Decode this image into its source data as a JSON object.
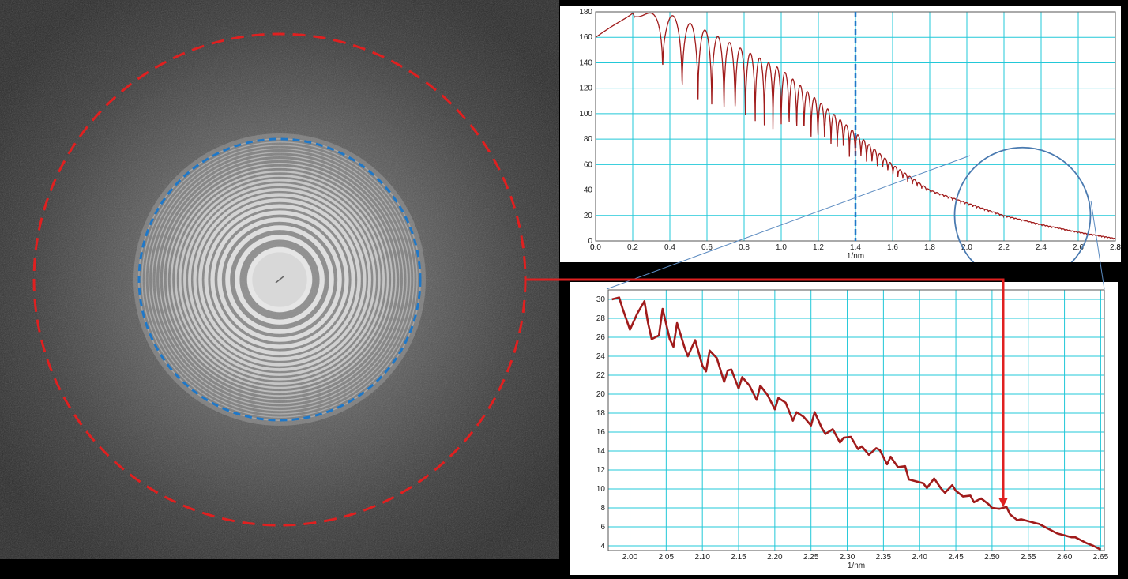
{
  "colors": {
    "curve": "#a01b1b",
    "grid": "#22c8d8",
    "marker_blue": "#1f78c8",
    "circle_red": "#e02020",
    "zoom_circle": "#4a7ab0",
    "highlight": "#ffee00"
  },
  "fft_image": {
    "description_icon": "thon-rings-fft-icon",
    "ring_count_visible": 19
  },
  "chart_data": [
    {
      "type": "line",
      "title": "",
      "xlabel": "1/nm",
      "ylabel": "",
      "xlim": [
        0.0,
        2.8
      ],
      "ylim": [
        0,
        180
      ],
      "x_ticks": [
        "0.0",
        "0.2",
        "0.4",
        "0.6",
        "0.8",
        "1.0",
        "1.2",
        "1.4",
        "1.6",
        "1.8",
        "2.0",
        "2.2",
        "2.4",
        "2.6",
        "2.8"
      ],
      "y_ticks": [
        "0",
        "20",
        "40",
        "60",
        "80",
        "100",
        "120",
        "140",
        "160",
        "180"
      ],
      "marker_x": 1.4,
      "envelope": {
        "x": [
          0.0,
          0.2,
          0.4,
          0.6,
          0.8,
          1.0,
          1.2,
          1.4,
          1.6,
          1.8,
          2.0,
          2.2,
          2.4,
          2.6,
          2.8
        ],
        "upper": [
          160,
          180,
          178,
          165,
          150,
          135,
          110,
          85,
          60,
          40,
          30,
          20,
          13,
          7,
          2
        ],
        "lower": [
          135,
          178,
          115,
          95,
          85,
          80,
          72,
          62,
          50,
          38,
          28,
          19,
          12,
          6,
          1
        ]
      },
      "zoom_circle_center_x": 2.3,
      "zoom_circle_center_y": 20
    },
    {
      "type": "line",
      "title": "",
      "xlabel": "1/nm",
      "ylabel": "",
      "xlim": [
        1.97,
        2.655
      ],
      "ylim": [
        3.5,
        31
      ],
      "x_ticks": [
        "2.00",
        "2.05",
        "2.10",
        "2.15",
        "2.20",
        "2.25",
        "2.30",
        "2.35",
        "2.40",
        "2.45",
        "2.50",
        "2.55",
        "2.60",
        "2.65"
      ],
      "y_ticks": [
        "4",
        "6",
        "8",
        "10",
        "12",
        "14",
        "16",
        "18",
        "20",
        "22",
        "24",
        "26",
        "28",
        "30"
      ],
      "x": [
        1.975,
        1.985,
        1.99,
        2.0,
        2.01,
        2.02,
        2.025,
        2.03,
        2.04,
        2.045,
        2.055,
        2.06,
        2.065,
        2.075,
        2.08,
        2.09,
        2.1,
        2.105,
        2.11,
        2.12,
        2.13,
        2.135,
        2.14,
        2.15,
        2.155,
        2.165,
        2.175,
        2.18,
        2.19,
        2.2,
        2.205,
        2.215,
        2.225,
        2.23,
        2.24,
        2.25,
        2.255,
        2.265,
        2.27,
        2.28,
        2.29,
        2.295,
        2.305,
        2.315,
        2.32,
        2.33,
        2.34,
        2.345,
        2.355,
        2.36,
        2.37,
        2.38,
        2.385,
        2.395,
        2.405,
        2.41,
        2.42,
        2.43,
        2.435,
        2.445,
        2.45,
        2.46,
        2.47,
        2.475,
        2.485,
        2.495,
        2.5,
        2.51,
        2.52,
        2.525,
        2.535,
        2.54,
        2.55,
        2.56,
        2.565,
        2.575,
        2.585,
        2.59,
        2.6,
        2.61,
        2.615,
        2.625,
        2.63,
        2.64,
        2.65
      ],
      "y": [
        30.0,
        30.2,
        29.0,
        26.8,
        28.5,
        29.8,
        27.5,
        25.8,
        26.2,
        29.0,
        25.8,
        25.0,
        27.5,
        25.0,
        24.0,
        25.7,
        23.0,
        22.4,
        24.6,
        23.8,
        21.3,
        22.5,
        22.6,
        20.6,
        21.8,
        20.9,
        19.4,
        20.9,
        19.9,
        18.4,
        19.6,
        19.1,
        17.2,
        18.1,
        17.6,
        16.7,
        18.1,
        16.4,
        15.8,
        16.3,
        14.9,
        15.4,
        15.5,
        14.2,
        14.5,
        13.6,
        14.3,
        14.1,
        12.6,
        13.4,
        12.3,
        12.4,
        11.0,
        10.8,
        10.6,
        10.1,
        11.1,
        10.0,
        9.6,
        10.4,
        9.8,
        9.2,
        9.3,
        8.6,
        9.0,
        8.4,
        8.0,
        7.9,
        8.1,
        7.3,
        6.7,
        6.8,
        6.6,
        6.4,
        6.3,
        5.9,
        5.5,
        5.3,
        5.1,
        4.9,
        4.9,
        4.5,
        4.3,
        4.0,
        3.6
      ]
    }
  ],
  "annotations": {
    "red_arrow_target_x": 2.52
  }
}
